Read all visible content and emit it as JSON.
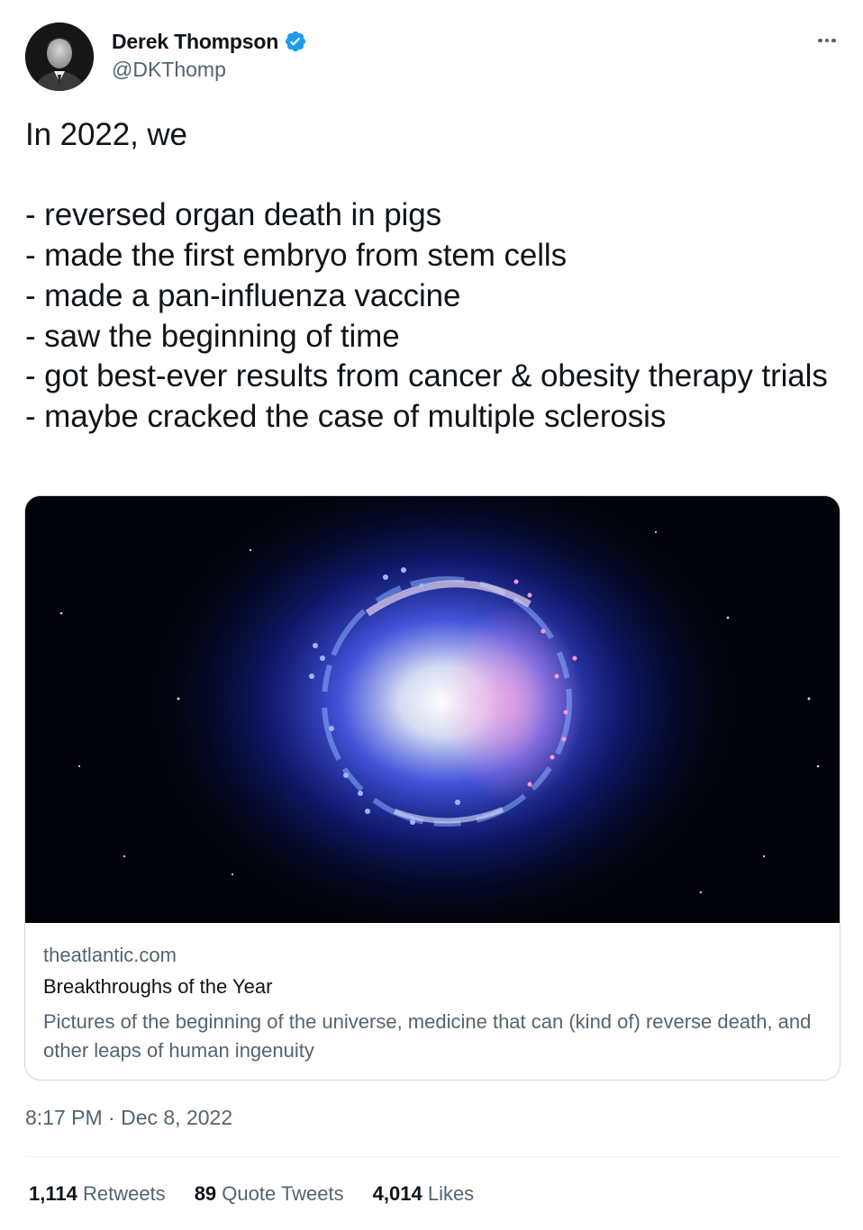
{
  "author": {
    "display_name": "Derek Thompson",
    "handle": "@DKThomp",
    "verified": true,
    "verified_color": "#1d9bf0"
  },
  "tweet": {
    "text": "In 2022, we\n\n- reversed organ death in pigs\n- made the first embryo from stem cells\n- made a pan-influenza vaccine\n- saw the beginning of time\n- got best-ever results from cancer & obesity therapy trials\n- maybe cracked the case of multiple sclerosis",
    "timestamp": "8:17 PM · Dec 8, 2022"
  },
  "link_card": {
    "domain": "theatlantic.com",
    "title": "Breakthroughs of the Year",
    "description": "Pictures of the beginning of the universe, medicine that can (kind of) reverse death, and other leaps of human ingenuity"
  },
  "stats": {
    "retweets_count": "1,114",
    "retweets_label": "Retweets",
    "quote_tweets_count": "89",
    "quote_tweets_label": "Quote Tweets",
    "likes_count": "4,014",
    "likes_label": "Likes"
  },
  "icons": {
    "more": "more-icon",
    "verified": "verified-badge-icon"
  }
}
